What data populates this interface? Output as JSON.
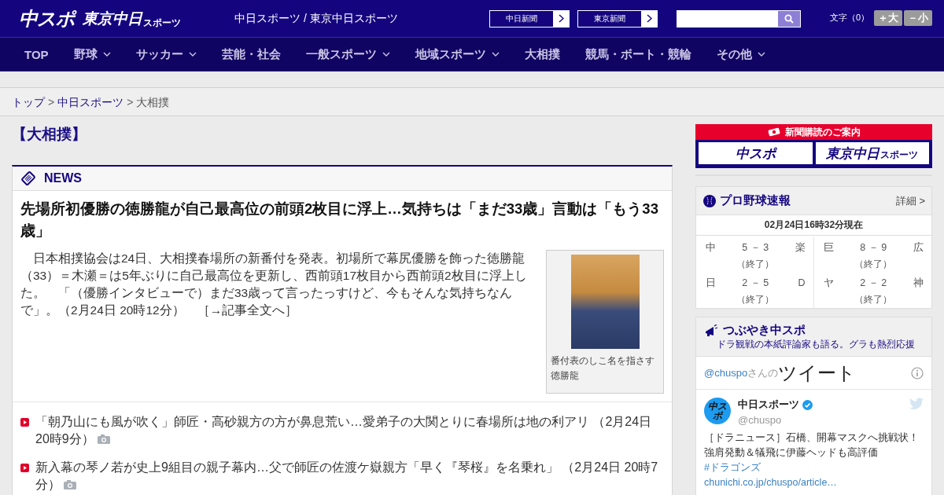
{
  "header": {
    "logo_main": "中スポ",
    "logo_sub": "東京中日",
    "logo_sub_small": "スポーツ",
    "tagline": "中日スポーツ / 東京中日スポーツ",
    "links": [
      {
        "label": "中日新聞"
      },
      {
        "label": "東京新聞"
      }
    ],
    "font_size": {
      "label": "文字（0）",
      "buttons": [
        "＋大",
        "－小"
      ]
    }
  },
  "nav": [
    {
      "label": "TOP",
      "dropdown": false
    },
    {
      "label": "野球",
      "dropdown": true
    },
    {
      "label": "サッカー",
      "dropdown": true
    },
    {
      "label": "芸能・社会",
      "dropdown": false
    },
    {
      "label": "一般スポーツ",
      "dropdown": true
    },
    {
      "label": "地域スポーツ",
      "dropdown": true
    },
    {
      "label": "大相撲",
      "dropdown": false
    },
    {
      "label": "競馬・ボート・競輪",
      "dropdown": false
    },
    {
      "label": "その他",
      "dropdown": true
    }
  ],
  "breadcrumb": [
    {
      "label": "トップ",
      "link": true,
      "separator": ">"
    },
    {
      "label": "中日スポーツ",
      "link": true,
      "separator": ">"
    },
    {
      "label": "大相撲",
      "link": false
    }
  ],
  "page_title": "【大相撲】",
  "news": {
    "heading": "NEWS",
    "headline": "先場所初優勝の徳勝龍が自己最高位の前頭2枚目に浮上…気持ちは「まだ33歳」言動は「もう33歳」",
    "body": "　日本相撲協会は24日、大相撲春場所の新番付を発表。初場所で幕尻優勝を飾った徳勝龍（33）＝木瀬＝は5年ぶりに自己最高位を更新し、西前頭17枚目から西前頭2枚目に浮上した。　「（優勝インタビューで）まだ33歳って言ったっすけど、今もそんな気持ちなんで」。（2月24日 20時12分）　",
    "read_more": "［→記事全文へ］",
    "photo_caption": "番付表のしこ名を指さす徳勝龍",
    "list": [
      {
        "text": "「朝乃山にも風が吹く」師匠・高砂親方の方が鼻息荒い…愛弟子の大関とりに春場所は地の利アリ",
        "time": "（2月24日 20時9分）",
        "photo": true
      },
      {
        "text": "新入幕の琴ノ若が史上9組目の親子幕内…父で師匠の佐渡ケ嶽親方「早く『琴桜』を名乗れ」",
        "time": "（2月24日 20時7分）",
        "photo": true
      }
    ]
  },
  "sidebar": {
    "subscribe": {
      "title": "新聞購読のご案内",
      "logos": [
        {
          "main": "中スポ"
        },
        {
          "main": "東京中日",
          "small": "スポーツ"
        }
      ]
    },
    "baseball": {
      "title": "プロ野球速報",
      "detail": "詳細 >",
      "as_of": "02月24日16時32分現在",
      "games": [
        {
          "home": "中",
          "score": "5 － 3",
          "away": "楽",
          "status": "（終了）"
        },
        {
          "home": "巨",
          "score": "8 － 9",
          "away": "広",
          "status": "（終了）"
        },
        {
          "home": "日",
          "score": "2 － 5",
          "away": "D",
          "status": "（終了）"
        },
        {
          "home": "ヤ",
          "score": "2 － 2",
          "away": "神",
          "status": "（終了）"
        }
      ]
    },
    "tweets": {
      "title": "つぶやき中スポ",
      "subtitle": "ドラ観戦の本紙評論家も語る。グラも熱烈応援",
      "handle": "@chuspo",
      "handle_suffix": "さんの",
      "heading": "ツイート",
      "tweet": {
        "avatar": "中スポ",
        "name": "中日スポーツ",
        "verified": true,
        "handle": "@chuspo",
        "text": "［ドラニュース］石橋、開幕マスクへ挑戦状！強肩発動＆犠飛に伊藤ヘッドも高評価",
        "hashtag": "#ドラゴンズ",
        "link": "chunichi.co.jp/chuspo/article…"
      }
    }
  }
}
